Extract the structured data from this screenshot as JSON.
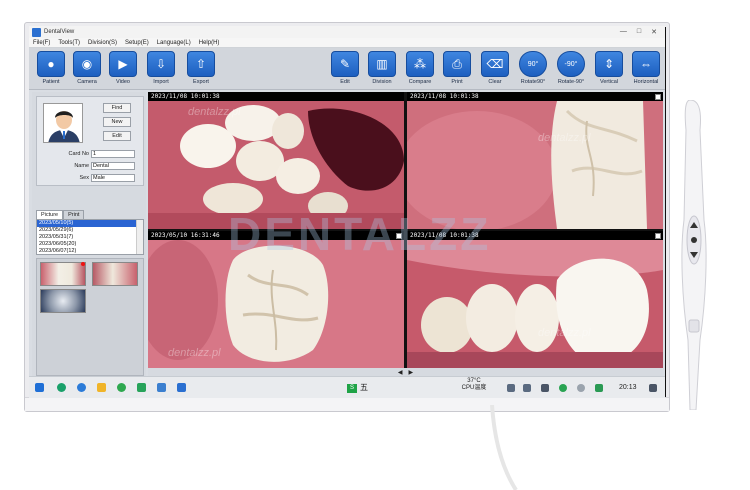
{
  "window": {
    "title": "DentalView",
    "controls": [
      "—",
      "□",
      "✕"
    ]
  },
  "menu": [
    "File(F)",
    "Tools(T)",
    "Division(S)",
    "Setup(E)",
    "Language(L)",
    "Help(H)"
  ],
  "toolbar_left": [
    {
      "label": "Patient",
      "icon": "person-icon",
      "glyph": "●"
    },
    {
      "label": "Camera",
      "icon": "camera-icon",
      "glyph": "◉"
    },
    {
      "label": "Video",
      "icon": "video-icon",
      "glyph": "▶"
    },
    {
      "label": "Import",
      "icon": "import-icon",
      "glyph": "⇩"
    },
    {
      "label": "Export",
      "icon": "export-icon",
      "glyph": "⇧"
    }
  ],
  "toolbar_right": [
    {
      "label": "Edit",
      "icon": "edit-icon",
      "glyph": "✎"
    },
    {
      "label": "Division",
      "icon": "division-icon",
      "glyph": "▥"
    },
    {
      "label": "Compare",
      "icon": "compare-icon",
      "glyph": "⁂"
    },
    {
      "label": "Print",
      "icon": "printer-icon",
      "glyph": "⎙"
    },
    {
      "label": "Clear",
      "icon": "broom-icon",
      "glyph": "⌫"
    },
    {
      "label": "Rotate90°",
      "icon": "rotate-cw-icon",
      "glyph": "90°"
    },
    {
      "label": "Rotate-90°",
      "icon": "rotate-ccw-icon",
      "glyph": "-90°"
    },
    {
      "label": "Vertical",
      "icon": "flip-vertical-icon",
      "glyph": "⇕"
    },
    {
      "label": "Horizontal",
      "icon": "flip-horizontal-icon",
      "glyph": "⇔"
    }
  ],
  "patient": {
    "buttons": {
      "find": "Find",
      "new": "New",
      "edit": "Edit"
    },
    "fields": [
      {
        "label": "Card No",
        "value": "1"
      },
      {
        "label": "Name",
        "value": "Dental"
      },
      {
        "label": "Sex",
        "value": "Male"
      }
    ]
  },
  "panel_tabs": [
    "Picture",
    "Print"
  ],
  "dates": [
    "2023/05/10(5)",
    "2023/05/29(6)",
    "2023/05/31(7)",
    "2023/06/05(20)",
    "2023/06/07(12)"
  ],
  "images": [
    {
      "timestamp": "2023/11/08 10:01:38"
    },
    {
      "timestamp": "2023/11/08 10:01:38"
    },
    {
      "timestamp": "2023/05/10 16:31:46"
    },
    {
      "timestamp": "2023/11/08 10:01:38"
    }
  ],
  "pager": {
    "prev": "◀",
    "next": "▶"
  },
  "taskbar": {
    "cpu": "37°C",
    "cpu_label": "CPU温度",
    "time": "20:13",
    "input_method": "五"
  },
  "watermarks": {
    "small": "dentalzz.pl",
    "big": "DENTALZZ"
  },
  "colors": {
    "accent": "#2a6fd0",
    "toolbar": "#d2d6dc",
    "selection": "#2a64d2"
  }
}
